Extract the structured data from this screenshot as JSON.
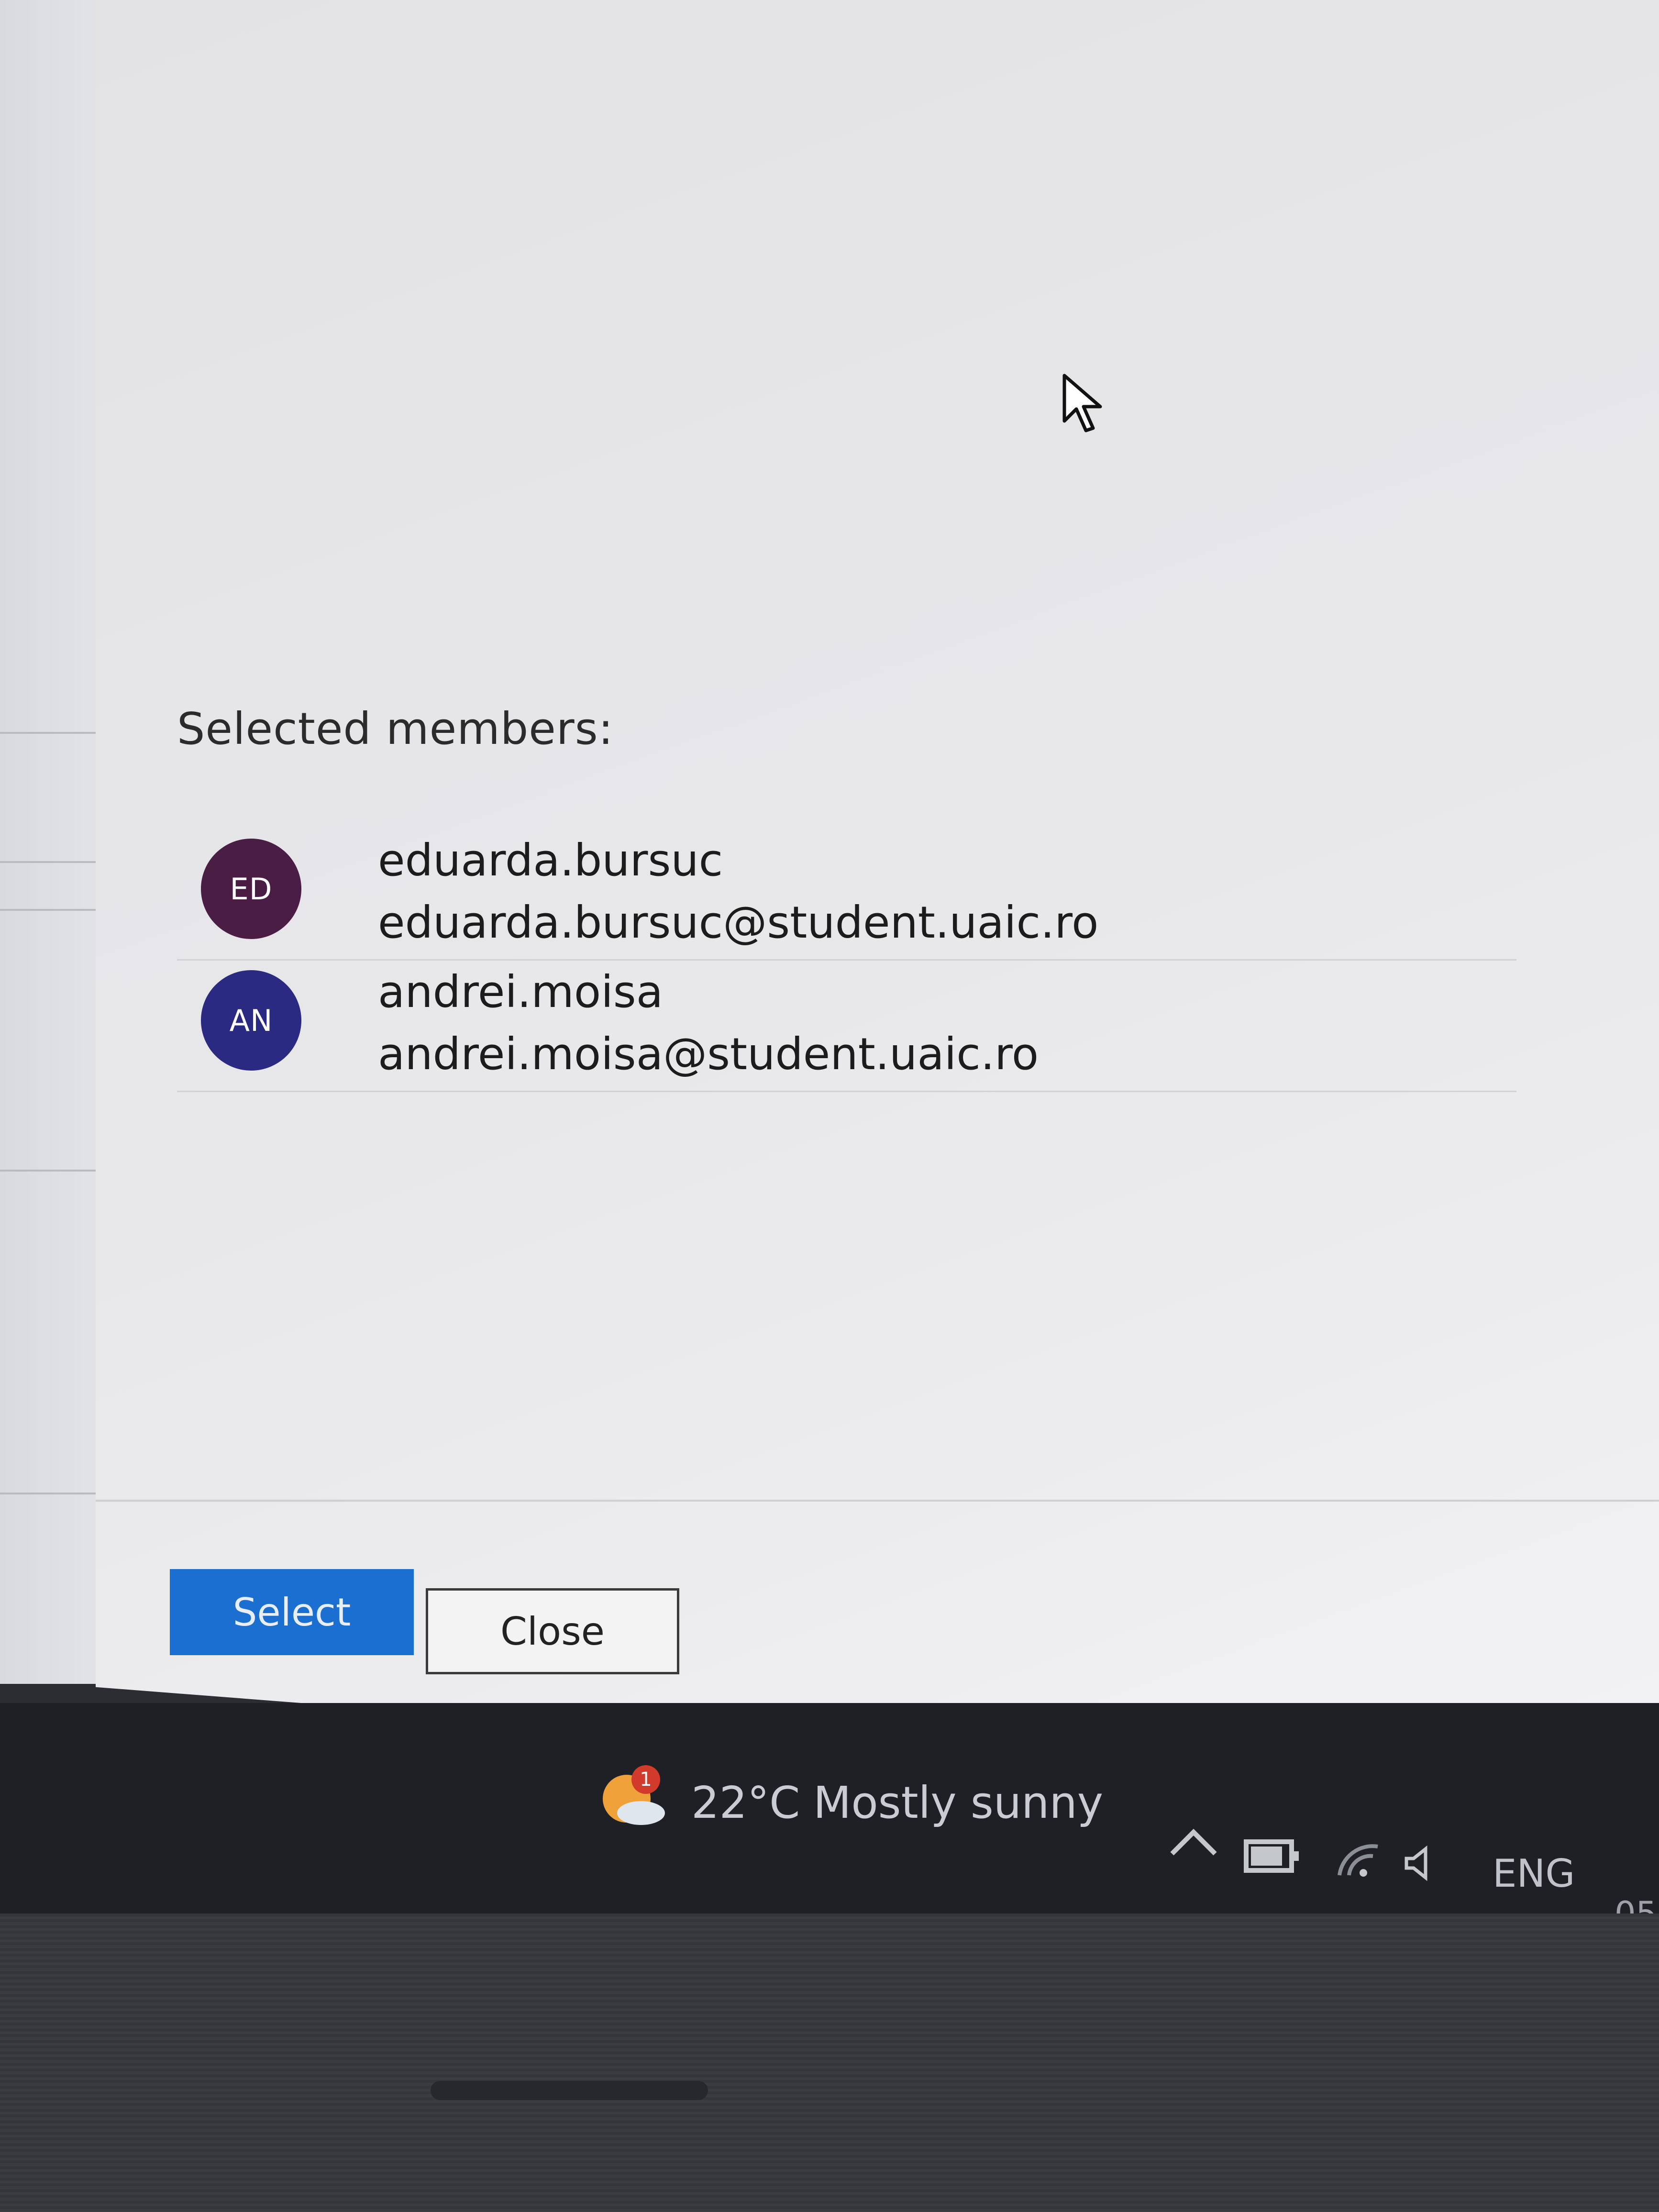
{
  "dialog": {
    "section_title": "Selected members:",
    "members": [
      {
        "initials": "ED",
        "name": "eduarda.bursuc",
        "email": "eduarda.bursuc@student.uaic.ro",
        "avatar_color": "#4a1d45"
      },
      {
        "initials": "AN",
        "name": "andrei.moisa",
        "email": "andrei.moisa@student.uaic.ro",
        "avatar_color": "#2b2a82"
      }
    ],
    "buttons": {
      "select_label": "Select",
      "close_label": "Close"
    },
    "accent_color": "#1a6fd0"
  },
  "taskbar": {
    "weather_badge": "1",
    "weather_temp": "22°C",
    "weather_desc": "Mostly sunny",
    "tray_icons": [
      "chevron-up-icon",
      "battery-icon",
      "wifi-icon",
      "volume-icon"
    ],
    "language": "ENG",
    "clock_partial": "05"
  }
}
